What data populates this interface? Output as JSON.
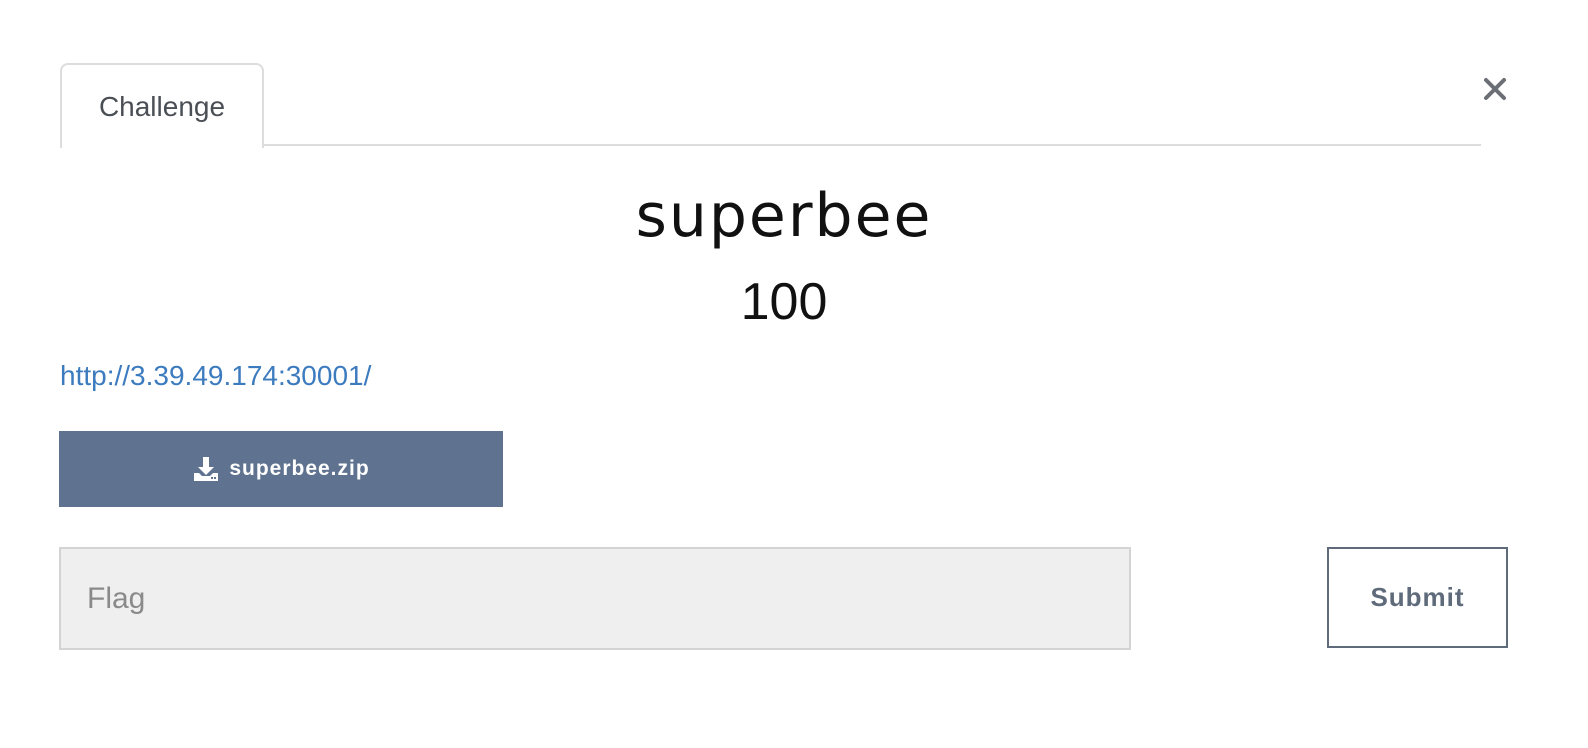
{
  "tabs": [
    {
      "label": "Challenge",
      "active": true
    }
  ],
  "close_icon": "close-icon",
  "challenge": {
    "name": "superbee",
    "points": "100",
    "link": "http://3.39.49.174:30001/",
    "file": {
      "icon": "download-icon",
      "name": "superbee.zip"
    }
  },
  "flag_form": {
    "placeholder": "Flag",
    "value": "",
    "submit_label": "Submit"
  },
  "colors": {
    "download_button_bg": "#5f7390",
    "link": "#3d7bbf",
    "input_bg": "#efefef",
    "submit_border": "#5f6b7b"
  }
}
